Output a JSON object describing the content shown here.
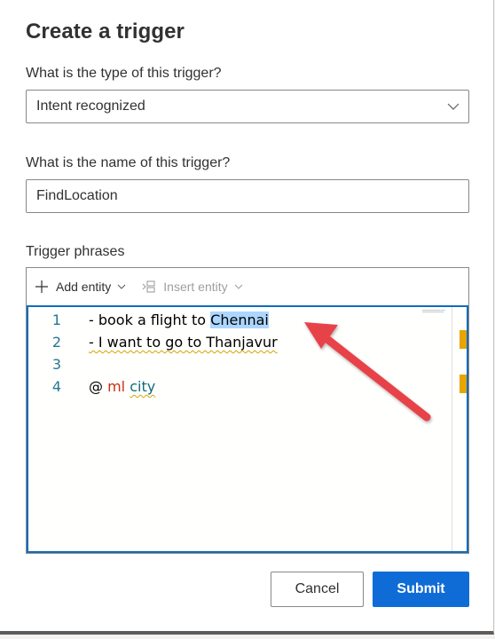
{
  "dialog": {
    "title": "Create a trigger",
    "type_label": "What is the type of this trigger?",
    "type_value": "Intent recognized",
    "name_label": "What is the name of this trigger?",
    "name_value": "FindLocation",
    "phrases_label": "Trigger phrases"
  },
  "toolbar": {
    "add_entity": "Add entity",
    "insert_entity": "Insert entity"
  },
  "editor": {
    "lines": [
      {
        "num": "1",
        "pre": "- book a flight to ",
        "hl": "Chennai"
      },
      {
        "num": "2",
        "sq": "- I want to go to Thanjavur"
      },
      {
        "num": "3"
      },
      {
        "num": "4",
        "at": "@ ",
        "kw": "ml",
        "ent": "city"
      }
    ]
  },
  "buttons": {
    "cancel": "Cancel",
    "submit": "Submit"
  },
  "colors": {
    "accent": "#0f6cd6",
    "focus_border": "#0f6cbd",
    "arrow": "#e8424a",
    "selection": "#add6ff",
    "warning_marker": "#e8a400"
  },
  "icons": {
    "chevron": "chevron-down-icon",
    "add": "plus-icon",
    "insert": "insert-entity-icon",
    "annotation": "red-arrow-annotation"
  }
}
